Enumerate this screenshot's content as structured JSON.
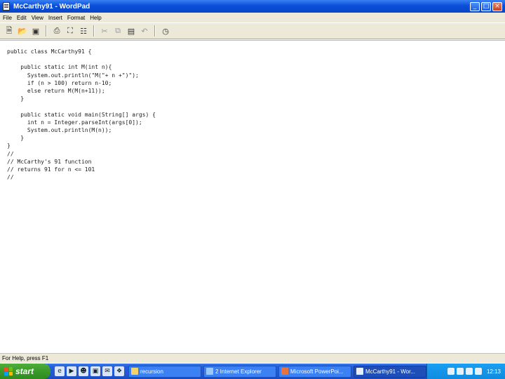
{
  "window": {
    "title": "McCarthy91 - WordPad",
    "minimize": "_",
    "maximize": "□",
    "close": "×"
  },
  "menu": [
    "File",
    "Edit",
    "View",
    "Insert",
    "Format",
    "Help"
  ],
  "toolbar": {
    "icons": [
      "new-icon",
      "open-icon",
      "save-icon",
      "print-icon",
      "print-preview-icon",
      "find-icon",
      "cut-icon",
      "copy-icon",
      "paste-icon",
      "undo-icon",
      "date-time-icon"
    ]
  },
  "document": {
    "code": "public class McCarthy91 {\n\n    public static int M(int n){\n      System.out.println(\"M(\"+ n +\")\");\n      if (n > 100) return n-10;\n      else return M(M(n+11));\n    }\n\n    public static void main(String[] args) {\n      int n = Integer.parseInt(args[0]);\n      System.out.println(M(n));\n    }\n}\n//\n// McCarthy's 91 function\n// returns 91 for n <= 101\n//"
  },
  "status": {
    "text": "For Help, press F1"
  },
  "taskbar": {
    "start_label": "start",
    "quick_launch": [
      "ie-icon",
      "media-icon",
      "messenger-icon",
      "desktop-icon",
      "outlook-icon",
      "windows-icon"
    ],
    "tasks": [
      {
        "label": "recursion",
        "icon": "folder-icon",
        "active": false
      },
      {
        "label": "2 Internet Explorer",
        "icon": "ie-icon",
        "active": false
      },
      {
        "label": "Microsoft PowerPoi...",
        "icon": "powerpoint-icon",
        "active": false
      },
      {
        "label": "McCarthy91 - Wor...",
        "icon": "wordpad-icon",
        "active": true
      }
    ],
    "clock": "12:13"
  }
}
